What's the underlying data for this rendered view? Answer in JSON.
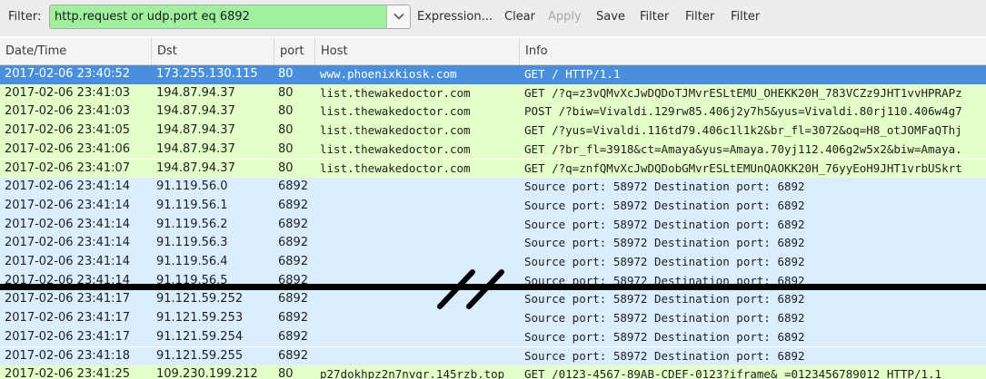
{
  "filter": {
    "label": "Filter:",
    "value": "http.request or udp.port eq 6892",
    "valid_color": "#a0f0a0"
  },
  "toolbar": {
    "expression": "Expression...",
    "clear": "Clear",
    "apply": "Apply",
    "save": "Save",
    "filter_1": "Filter",
    "filter_2": "Filter",
    "filter_3": "Filter"
  },
  "columns": {
    "time": "Date/Time",
    "dst": "Dst",
    "port": "port",
    "host": "Host",
    "info": "Info"
  },
  "rows": [
    {
      "time": "2017-02-06 23:40:52",
      "dst": "173.255.130.115",
      "port": "80",
      "host": "www.phoenixkiosk.com",
      "info": "GET / HTTP/1.1",
      "type": "http",
      "selected": true
    },
    {
      "time": "2017-02-06 23:41:03",
      "dst": "194.87.94.37",
      "port": "80",
      "host": "list.thewakedoctor.com",
      "info": "GET /?q=z3vQMvXcJwDQDoTJMvrESLtEMU_OHEKK20H_783VCZz9JHT1vvHPRAPz",
      "type": "http",
      "selected": false
    },
    {
      "time": "2017-02-06 23:41:03",
      "dst": "194.87.94.37",
      "port": "80",
      "host": "list.thewakedoctor.com",
      "info": "POST /?biw=Vivaldi.129rw85.406j2y7h5&yus=Vivaldi.80rj110.406w4g7",
      "type": "http",
      "selected": false
    },
    {
      "time": "2017-02-06 23:41:05",
      "dst": "194.87.94.37",
      "port": "80",
      "host": "list.thewakedoctor.com",
      "info": "GET /?yus=Vivaldi.116td79.406c1l1k2&br_fl=3072&oq=H8_otJOMFaQThj",
      "type": "http",
      "selected": false
    },
    {
      "time": "2017-02-06 23:41:06",
      "dst": "194.87.94.37",
      "port": "80",
      "host": "list.thewakedoctor.com",
      "info": "GET /?br_fl=3918&ct=Amaya&yus=Amaya.70yj112.406g2w5x2&biw=Amaya.",
      "type": "http",
      "selected": false
    },
    {
      "time": "2017-02-06 23:41:07",
      "dst": "194.87.94.37",
      "port": "80",
      "host": "list.thewakedoctor.com",
      "info": "GET /?q=znfQMvXcJwDQDobGMvrESLtEMUnQAOKK20H_76yyEoH9JHT1vrbUSkrt",
      "type": "http",
      "selected": false
    },
    {
      "time": "2017-02-06 23:41:14",
      "dst": "91.119.56.0",
      "port": "6892",
      "host": "",
      "info": "Source port: 58972  Destination port: 6892",
      "type": "udp",
      "selected": false
    },
    {
      "time": "2017-02-06 23:41:14",
      "dst": "91.119.56.1",
      "port": "6892",
      "host": "",
      "info": "Source port: 58972  Destination port: 6892",
      "type": "udp",
      "selected": false
    },
    {
      "time": "2017-02-06 23:41:14",
      "dst": "91.119.56.2",
      "port": "6892",
      "host": "",
      "info": "Source port: 58972  Destination port: 6892",
      "type": "udp",
      "selected": false
    },
    {
      "time": "2017-02-06 23:41:14",
      "dst": "91.119.56.3",
      "port": "6892",
      "host": "",
      "info": "Source port: 58972  Destination port: 6892",
      "type": "udp",
      "selected": false
    },
    {
      "time": "2017-02-06 23:41:14",
      "dst": "91.119.56.4",
      "port": "6892",
      "host": "",
      "info": "Source port: 58972  Destination port: 6892",
      "type": "udp",
      "selected": false
    },
    {
      "time": "2017-02-06 23:41:14",
      "dst": "91.119.56.5",
      "port": "6892",
      "host": "",
      "info": "Source port: 58972  Destination port: 6892",
      "type": "udp",
      "selected": false
    },
    {
      "time": "2017-02-06 23:41:17",
      "dst": "91.121.59.252",
      "port": "6892",
      "host": "",
      "info": "Source port: 58972  Destination port: 6892",
      "type": "udp",
      "selected": false
    },
    {
      "time": "2017-02-06 23:41:17",
      "dst": "91.121.59.253",
      "port": "6892",
      "host": "",
      "info": "Source port: 58972  Destination port: 6892",
      "type": "udp",
      "selected": false
    },
    {
      "time": "2017-02-06 23:41:17",
      "dst": "91.121.59.254",
      "port": "6892",
      "host": "",
      "info": "Source port: 58972  Destination port: 6892",
      "type": "udp",
      "selected": false
    },
    {
      "time": "2017-02-06 23:41:18",
      "dst": "91.121.59.255",
      "port": "6892",
      "host": "",
      "info": "Source port: 58972  Destination port: 6892",
      "type": "udp",
      "selected": false
    },
    {
      "time": "2017-02-06 23:41:25",
      "dst": "109.230.199.212",
      "port": "80",
      "host": "p27dokhpz2n7nvgr.145rzb.top",
      "info": "GET /0123-4567-89AB-CDEF-0123?iframe&_=0123456789012 HTTP/1.1",
      "type": "http",
      "selected": false
    }
  ],
  "colors": {
    "http_row": "#e4ffc7",
    "udp_row": "#daeeff",
    "selected_row": "#4a8fdc",
    "toolbar_bg": "#ededed"
  },
  "icons": {
    "filter_dropdown": "chevron-down-icon",
    "break_marker": "break-slash-icon"
  }
}
